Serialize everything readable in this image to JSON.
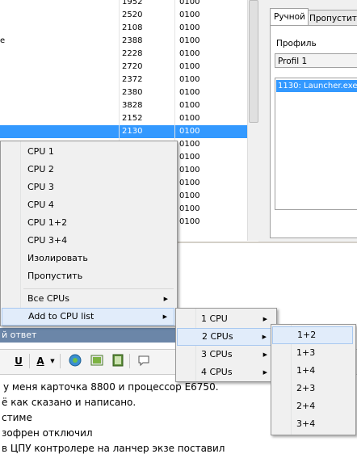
{
  "process_table": {
    "rows": [
      {
        "name": "",
        "pid": "1952",
        "affinity": "0100"
      },
      {
        "name": "",
        "pid": "2520",
        "affinity": "0100"
      },
      {
        "name": "",
        "pid": "2108",
        "affinity": "0100"
      },
      {
        "name": "e",
        "pid": "2388",
        "affinity": "0100"
      },
      {
        "name": "",
        "pid": "2228",
        "affinity": "0100"
      },
      {
        "name": "",
        "pid": "2720",
        "affinity": "0100"
      },
      {
        "name": "",
        "pid": "2372",
        "affinity": "0100"
      },
      {
        "name": "",
        "pid": "2380",
        "affinity": "0100"
      },
      {
        "name": "",
        "pid": "3828",
        "affinity": "0100"
      },
      {
        "name": "",
        "pid": "2152",
        "affinity": "0100"
      },
      {
        "name": "",
        "pid": "2130",
        "affinity": "0100"
      },
      {
        "name": "",
        "pid": "",
        "affinity": "0100"
      },
      {
        "name": "",
        "pid": "",
        "affinity": "0100"
      },
      {
        "name": "",
        "pid": "",
        "affinity": "0100"
      },
      {
        "name": "",
        "pid": "",
        "affinity": "0100"
      },
      {
        "name": "",
        "pid": "",
        "affinity": "0100"
      },
      {
        "name": "",
        "pid": "",
        "affinity": "0100"
      },
      {
        "name": "",
        "pid": "",
        "affinity": "0100"
      }
    ],
    "selected_color": "#3399ff"
  },
  "right_panel": {
    "tab_manual": "Ручной",
    "tab_skip": "Пропустить",
    "profile_label": "Профиль",
    "profile_value": "Profil 1",
    "process_item": "1130: Launcher.exe"
  },
  "context_menu": {
    "items": [
      "CPU 1",
      "CPU 2",
      "CPU 3",
      "CPU 4",
      "CPU 1+2",
      "CPU 3+4",
      "Изолировать",
      "Пропустить"
    ],
    "all_cpus": "Все CPUs",
    "add_to_cpu_list": "Add to CPU list"
  },
  "submenu": {
    "items": [
      "1 CPU",
      "2 CPUs",
      "3 CPUs",
      "4 CPUs"
    ]
  },
  "submenu2": {
    "items": [
      "1+2",
      "1+3",
      "1+4",
      "2+3",
      "2+4",
      "3+4"
    ]
  },
  "forum": {
    "reply_bar": "й ответ",
    "toolbar_bold_u": "U",
    "toolbar_font_a": "A",
    "post_lines": [
      "у меня карточка 8800 и процессор E6750.",
      "ё как сказано и написано.",
      "стиме",
      "зофрен отключил",
      "в ЦПУ контролере на ланчер экзе поставил"
    ]
  }
}
